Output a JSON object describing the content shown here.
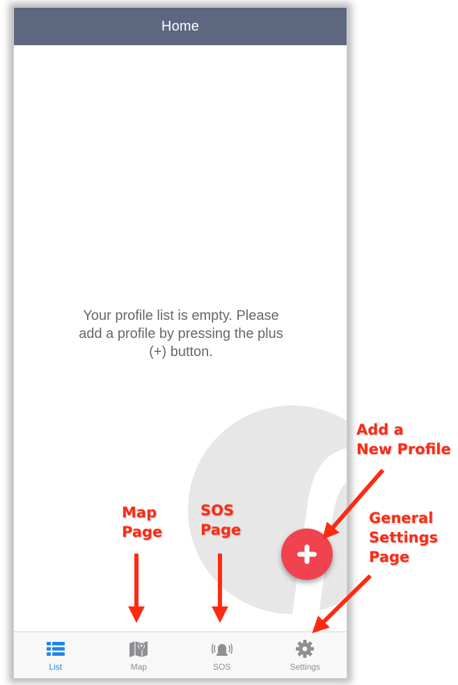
{
  "navbar": {
    "title": "Home"
  },
  "empty_state": {
    "line1": "Your profile list is empty. Please",
    "line2": "add a profile by pressing the plus",
    "line3": "(+) button."
  },
  "fab": {
    "icon": "plus-icon",
    "color": "#f0424f"
  },
  "tabs": [
    {
      "label": "List",
      "icon": "list-icon",
      "active": true
    },
    {
      "label": "Map",
      "icon": "map-icon",
      "active": false
    },
    {
      "label": "SOS",
      "icon": "sos-alarm-icon",
      "active": false
    },
    {
      "label": "Settings",
      "icon": "gear-icon",
      "active": false
    }
  ],
  "annotations": {
    "add": {
      "line1": "Add a",
      "line2": "New Profile"
    },
    "map": {
      "line1": "Map",
      "line2": "Page"
    },
    "sos": {
      "line1": "SOS",
      "line2": "Page"
    },
    "settings": {
      "line1": "General",
      "line2": "Settings",
      "line3": "Page"
    },
    "color": "#ff2a12"
  },
  "colors": {
    "navbar": "#5d6780",
    "active_tab": "#1d86e8",
    "inactive_tab": "#8e8e93"
  }
}
